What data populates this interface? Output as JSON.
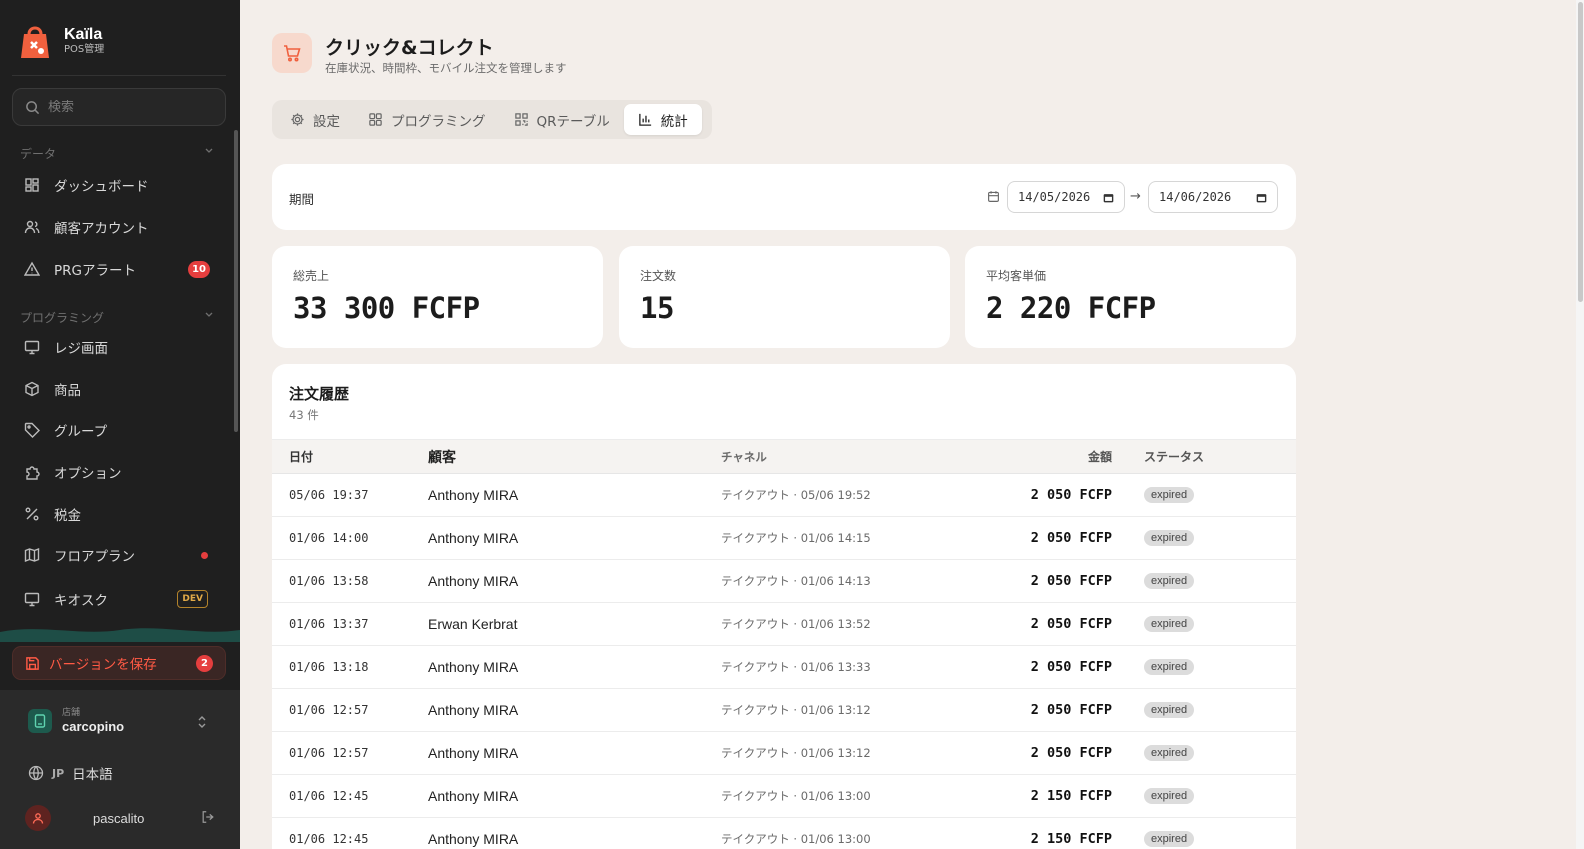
{
  "brand": {
    "name": "Kaïla",
    "sub": "POS管理"
  },
  "search": {
    "placeholder": "検索"
  },
  "sidebar": {
    "section_data": "データ",
    "section_prog": "プログラミング",
    "items": [
      {
        "label": "ダッシュボード",
        "icon": "dashboard-icon"
      },
      {
        "label": "顧客アカウント",
        "icon": "users-icon"
      },
      {
        "label": "PRGアラート",
        "icon": "alert-icon",
        "badge": "10"
      },
      {
        "label": "レジ画面",
        "icon": "monitor-icon"
      },
      {
        "label": "商品",
        "icon": "box-icon"
      },
      {
        "label": "グループ",
        "icon": "tag-icon"
      },
      {
        "label": "オプション",
        "icon": "puzzle-icon"
      },
      {
        "label": "税金",
        "icon": "percent-icon"
      },
      {
        "label": "フロアプラン",
        "icon": "map-icon"
      },
      {
        "label": "キオスク",
        "icon": "monitor-icon",
        "badge": "DEV"
      }
    ],
    "save_label": "バージョンを保存",
    "save_badge": "2",
    "store_label": "店舗",
    "store_name": "carcopino",
    "lang_code": "JP",
    "lang_label": "日本語",
    "user_name": "pascalito"
  },
  "header": {
    "title": "クリック&コレクト",
    "subtitle": "在庫状況、時間枠、モバイル注文を管理します"
  },
  "tabs": [
    {
      "label": "設定",
      "icon": "gear-icon"
    },
    {
      "label": "プログラミング",
      "icon": "grid-icon"
    },
    {
      "label": "QRテーブル",
      "icon": "qr-icon"
    },
    {
      "label": "統計",
      "icon": "bar-chart-icon",
      "active": true
    }
  ],
  "period": {
    "label": "期間",
    "from": "14/05/2026",
    "arrow": "→",
    "to": "14/06/2026"
  },
  "kpis": [
    {
      "label": "総売上",
      "value": "33 300 FCFP"
    },
    {
      "label": "注文数",
      "value": "15"
    },
    {
      "label": "平均客単価",
      "value": "2 220 FCFP"
    }
  ],
  "orders": {
    "title": "注文履歴",
    "count": "43 件",
    "columns": [
      "日付",
      "顧客",
      "チャネル",
      "金額",
      "ステータス"
    ],
    "rows": [
      [
        "05/06 19:37",
        "Anthony MIRA",
        "テイクアウト · 05/06 19:52",
        "2 050 FCFP",
        "expired"
      ],
      [
        "01/06 14:00",
        "Anthony MIRA",
        "テイクアウト · 01/06 14:15",
        "2 050 FCFP",
        "expired"
      ],
      [
        "01/06 13:58",
        "Anthony MIRA",
        "テイクアウト · 01/06 14:13",
        "2 050 FCFP",
        "expired"
      ],
      [
        "01/06 13:37",
        "Erwan Kerbrat",
        "テイクアウト · 01/06 13:52",
        "2 050 FCFP",
        "expired"
      ],
      [
        "01/06 13:18",
        "Anthony MIRA",
        "テイクアウト · 01/06 13:33",
        "2 050 FCFP",
        "expired"
      ],
      [
        "01/06 12:57",
        "Anthony MIRA",
        "テイクアウト · 01/06 13:12",
        "2 050 FCFP",
        "expired"
      ],
      [
        "01/06 12:57",
        "Anthony MIRA",
        "テイクアウト · 01/06 13:12",
        "2 050 FCFP",
        "expired"
      ],
      [
        "01/06 12:45",
        "Anthony MIRA",
        "テイクアウト · 01/06 13:00",
        "2 150 FCFP",
        "expired"
      ],
      [
        "01/06 12:45",
        "Anthony MIRA",
        "テイクアウト · 01/06 13:00",
        "2 150 FCFP",
        "expired"
      ]
    ]
  },
  "colors": {
    "accent": "#f0603e",
    "sidebar_bg": "#1f1f1f",
    "page_bg": "#f3eeea",
    "danger": "#e53e3e"
  }
}
